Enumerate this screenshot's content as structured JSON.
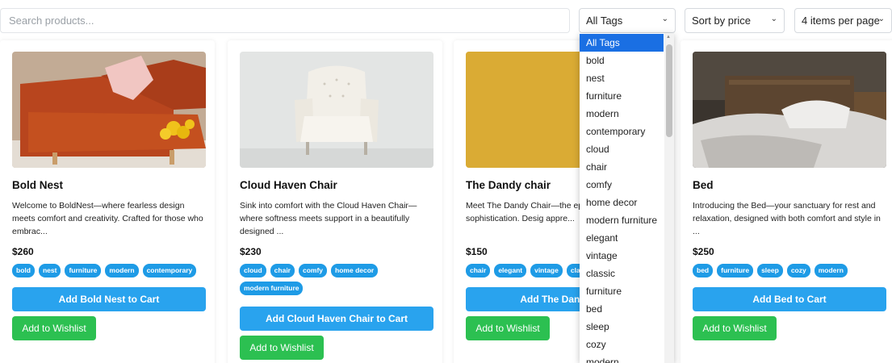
{
  "search": {
    "placeholder": "Search products...",
    "value": ""
  },
  "filters": {
    "tags_selected": "All Tags",
    "sort_selected": "Sort by price",
    "per_page_selected": "4 items per page"
  },
  "products": [
    {
      "name": "Bold Nest",
      "description": "Welcome to BoldNest—where fearless design meets comfort and creativity. Crafted for those who embrac...",
      "price": "$260",
      "tags": [
        "bold",
        "nest",
        "furniture",
        "modern",
        "contemporary"
      ],
      "cart_label": "Add Bold Nest to Cart",
      "wishlist_label": "Add to Wishlist"
    },
    {
      "name": "Cloud Haven Chair",
      "description": "Sink into comfort with the Cloud Haven Chair—where softness meets support in a beautifully designed ...",
      "price": "$230",
      "tags": [
        "cloud",
        "chair",
        "comfy",
        "home decor",
        "modern furniture"
      ],
      "cart_label": "Add Cloud Haven Chair to Cart",
      "wishlist_label": "Add to Wishlist"
    },
    {
      "name": "The Dandy chair",
      "description": "Meet The Dandy Chair—the ep style, and sophistication. Desig appre...",
      "price": "$150",
      "tags": [
        "chair",
        "elegant",
        "vintage",
        "class"
      ],
      "cart_label": "Add The Dandy ch",
      "wishlist_label": "Add to Wishlist"
    },
    {
      "name": "Bed",
      "description": "Introducing the Bed—your sanctuary for rest and relaxation, designed with both comfort and style in ...",
      "price": "$250",
      "tags": [
        "bed",
        "furniture",
        "sleep",
        "cozy",
        "modern"
      ],
      "cart_label": "Add Bed to Cart",
      "wishlist_label": "Add to Wishlist"
    }
  ],
  "tag_dropdown": {
    "options": [
      "All Tags",
      "bold",
      "nest",
      "furniture",
      "modern",
      "contemporary",
      "cloud",
      "chair",
      "comfy",
      "home decor",
      "modern furniture",
      "elegant",
      "vintage",
      "classic",
      "furniture",
      "bed",
      "sleep",
      "cozy",
      "modern"
    ]
  },
  "colors": {
    "tag": "#1e9be6",
    "cart_button": "#29a3ee",
    "wishlist_button": "#2cc051",
    "dropdown_highlight": "#1a6fe3"
  }
}
